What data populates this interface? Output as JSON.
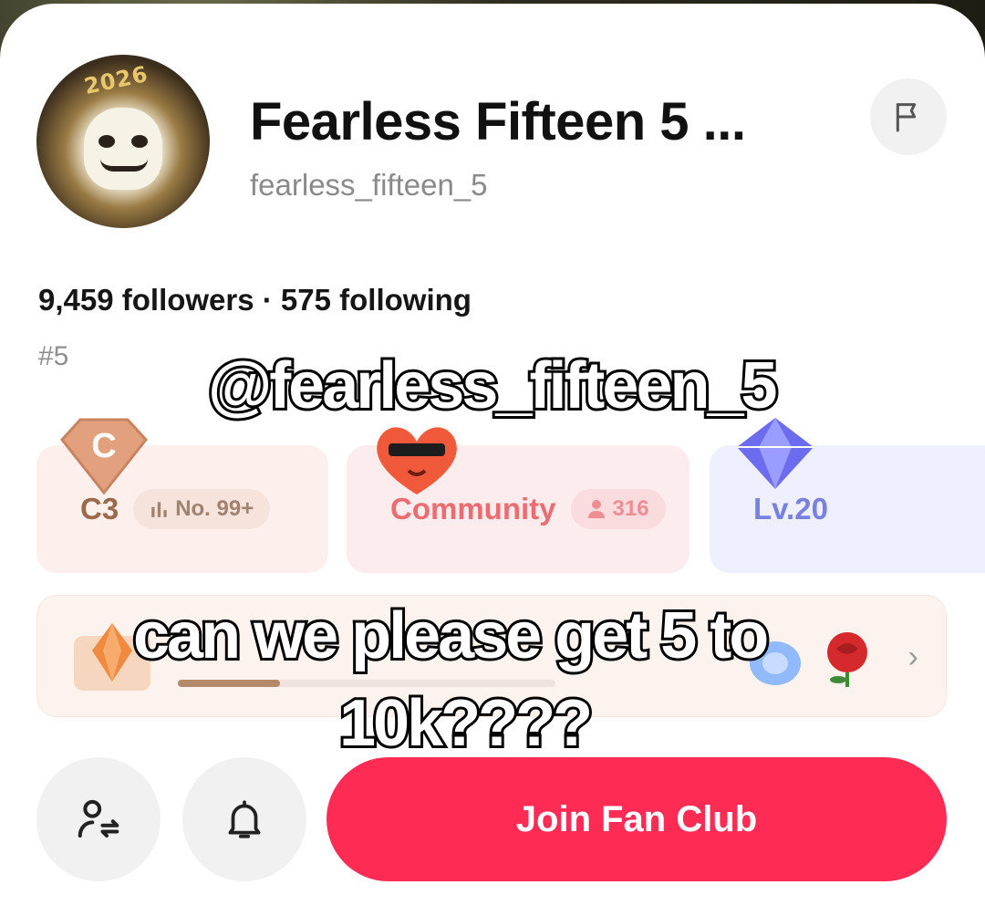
{
  "profile": {
    "display_name": "Fearless Fifteen 5 ...",
    "handle": "fearless_fifteen_5",
    "avatar_text": "2026",
    "followers_text": "9,459 followers · 575 following",
    "rank_tag": "#5"
  },
  "badges": {
    "level": {
      "label": "C3",
      "pill": "No. 99+"
    },
    "community": {
      "label": "Community",
      "pill": "316"
    },
    "lv": {
      "label": "Lv.20"
    }
  },
  "fan_club_row": {
    "progress_fraction": 0.27
  },
  "actions": {
    "join_label": "Join Fan Club"
  },
  "caption": {
    "line1": "@fearless_fifteen_5",
    "line2": "can we please get 5 to",
    "line3": "10k????"
  },
  "colors": {
    "accent": "#fe2c55"
  }
}
